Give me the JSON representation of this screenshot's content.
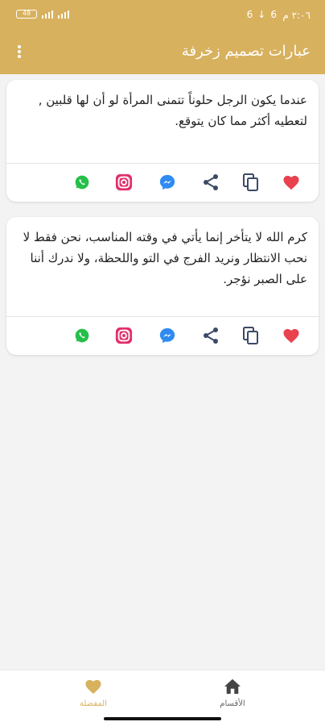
{
  "status_bar": {
    "time": "٢:٠٦ م",
    "battery": "48"
  },
  "app_bar": {
    "title": "عبارات تصميم زخرفة",
    "menu_icon": "more-vert-icon"
  },
  "cards": [
    {
      "text": "عندما يكون الرجل حلوناً تتمنى المرأة لو أن لها قلبين , لتعطيه أكثر مما كان يتوقع."
    },
    {
      "text": "كرم الله لا يتأخر إنما يأتي في وقته المناسب، نحن فقط لا نحب الانتظار ونريد الفرج في التو واللحظة، ولا ندرك أننا على الصبر نؤجر."
    }
  ],
  "action_icons": [
    "heart-icon",
    "copy-icon",
    "share-icon",
    "messenger-icon",
    "instagram-icon",
    "whatsapp-icon"
  ],
  "bottom_nav": {
    "favorites_label": "المفضلة",
    "sections_label": "الأقسام"
  },
  "colors": {
    "primary": "#d8b15e",
    "heart": "#e8424f",
    "messenger": "#2f8bf2",
    "instagram": "#e1306c",
    "whatsapp": "#25c04a",
    "icon_dark": "#3c4a66"
  }
}
